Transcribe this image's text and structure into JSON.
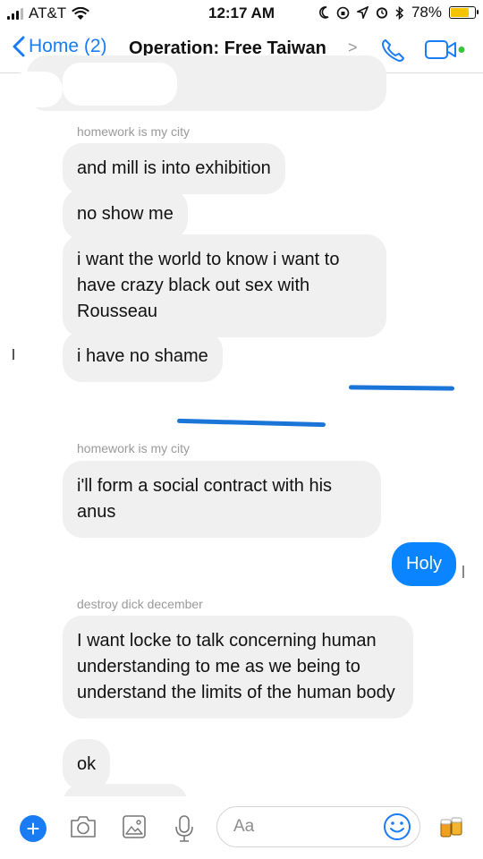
{
  "status_bar": {
    "carrier": "AT&T",
    "time": "12:17 AM",
    "battery": "78%",
    "battery_level": 0.78
  },
  "nav": {
    "back_label": "Home (2)",
    "title": "Operation: Free Taiwan",
    "chevron": ">"
  },
  "messages": [
    {
      "sender": "homework is my city"
    },
    {
      "text": "and mill is into exhibition"
    },
    {
      "text": "no show me"
    },
    {
      "text": "i want the world to know i want to have crazy black out sex with Rousseau"
    },
    {
      "text": "i have no shame"
    },
    {
      "sender": "homework is my city"
    },
    {
      "text": "i'll form a social contract with his anus"
    },
    {
      "text": "Holy",
      "outgoing": true
    },
    {
      "sender": "destroy dick december"
    },
    {
      "text": "I want locke to talk concerning human understanding to me as we being to understand the limits of the human body"
    },
    {
      "text": "ok"
    }
  ],
  "composer": {
    "placeholder": "Aa"
  },
  "colors": {
    "accent": "#1a7cf5",
    "incoming_bubble": "#f1f0f0",
    "outgoing_bubble": "#0b84ff",
    "battery": "#f5c400"
  }
}
